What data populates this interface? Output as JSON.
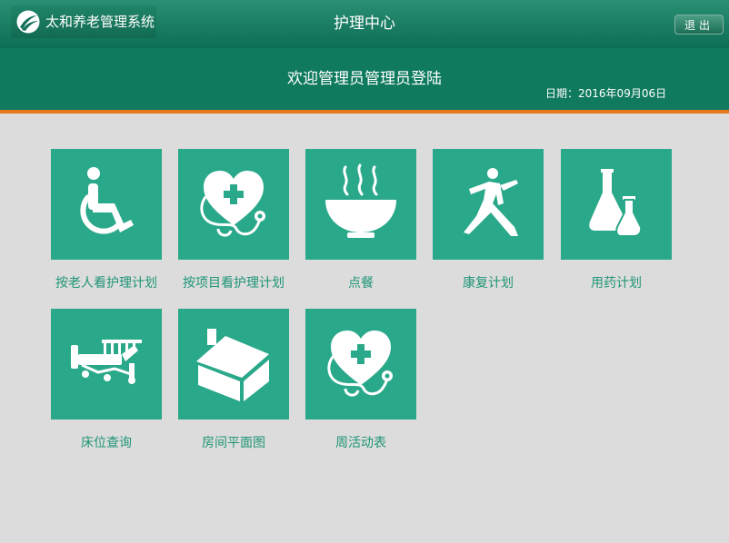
{
  "app": {
    "name": "太和养老管理系统",
    "module_title": "护理中心",
    "logout_label": "退出"
  },
  "header": {
    "welcome_text": "欢迎管理员管理员登陆",
    "date_label": "日期：",
    "date_value": "2016年09月06日"
  },
  "tiles": [
    {
      "label": "按老人看护理计划",
      "icon": "wheelchair-icon"
    },
    {
      "label": "按项目看护理计划",
      "icon": "heart-stethoscope-icon"
    },
    {
      "label": "点餐",
      "icon": "steaming-bowl-icon"
    },
    {
      "label": "康复计划",
      "icon": "martial-arts-icon"
    },
    {
      "label": "用药计划",
      "icon": "lab-flask-icon"
    },
    {
      "label": "床位查询",
      "icon": "hospital-bed-icon"
    },
    {
      "label": "房间平面图",
      "icon": "house-icon"
    },
    {
      "label": "周活动表",
      "icon": "heart-stethoscope-icon"
    }
  ],
  "colors": {
    "topbar": "#0d6e55",
    "header": "#0f7a5e",
    "accent_bar": "#e8781e",
    "tile": "#2aa88a",
    "label": "#1f9577",
    "background": "#dcdcdc"
  }
}
